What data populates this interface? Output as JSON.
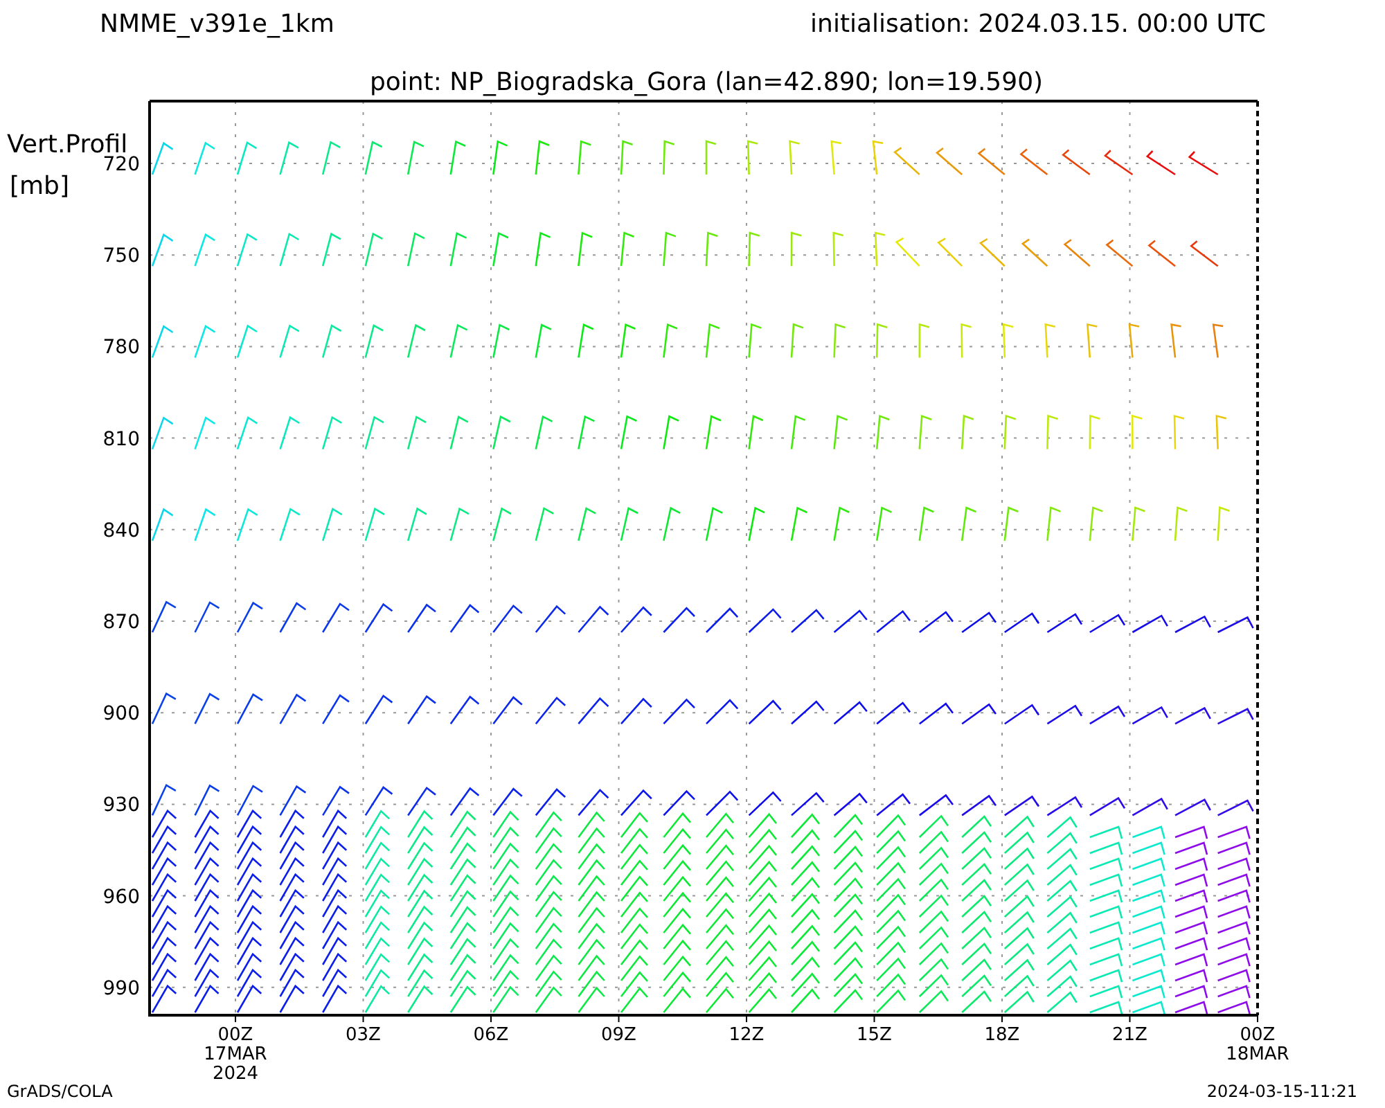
{
  "header": {
    "model": "NMME_v391e_1km",
    "initialisation": "initialisation: 2024.03.15. 00:00 UTC",
    "point": "point: NP_Biogradska_Gora (lan=42.890; lon=19.590)"
  },
  "y_axis": {
    "title": "Vert.Profil",
    "unit": "[mb]",
    "ticks": [
      "720",
      "750",
      "780",
      "810",
      "840",
      "870",
      "900",
      "930",
      "960",
      "990"
    ]
  },
  "x_axis": {
    "ticks": [
      {
        "label": "00Z",
        "lines": [
          "17MAR",
          "2024"
        ]
      },
      {
        "label": "03Z"
      },
      {
        "label": "06Z"
      },
      {
        "label": "09Z"
      },
      {
        "label": "12Z"
      },
      {
        "label": "15Z"
      },
      {
        "label": "18Z"
      },
      {
        "label": "21Z"
      },
      {
        "label": "00Z",
        "lines": [
          "18MAR"
        ]
      }
    ]
  },
  "footer": {
    "left": "GrADS/COLA",
    "right": "2024-03-15-11:21"
  }
}
